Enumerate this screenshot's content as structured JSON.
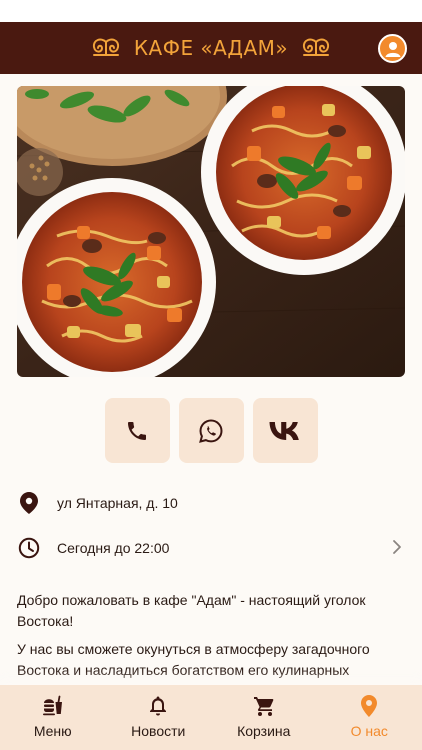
{
  "header": {
    "title": "КАФЕ «АДАМ»",
    "profile_icon": "user-circle-icon",
    "ornament_icon": "ornament-icon"
  },
  "colors": {
    "header_bg": "#4a1910",
    "accent": "#f28a2c",
    "title": "#f2a33a",
    "button_bg": "#f8e5d4",
    "icon_dark": "#3a1510"
  },
  "hero": {
    "image": "two bowls of lagman noodle soup with vegetables, meat and herbs on a wooden table"
  },
  "actions": [
    {
      "id": "phone",
      "icon": "phone-icon"
    },
    {
      "id": "whatsapp",
      "icon": "whatsapp-icon"
    },
    {
      "id": "vk",
      "icon": "vk-icon"
    }
  ],
  "info": {
    "address": "ул Янтарная, д. 10",
    "hours": "Сегодня до 22:00"
  },
  "description": {
    "p1": "Добро пожаловать в кафе \"Адам\" - настоящий уголок Востока!",
    "p2": "У нас вы сможете окунуться в атмосферу загадочного Востока и насладиться богатством его кулинарных традиций. В нашем меню представлены изысканные блюда восточной кухни,"
  },
  "tabs": [
    {
      "label": "Меню",
      "icon": "menu-burger-icon",
      "active": false
    },
    {
      "label": "Новости",
      "icon": "bell-icon",
      "active": false
    },
    {
      "label": "Корзина",
      "icon": "cart-icon",
      "active": false
    },
    {
      "label": "О нас",
      "icon": "location-pin-icon",
      "active": true
    }
  ]
}
